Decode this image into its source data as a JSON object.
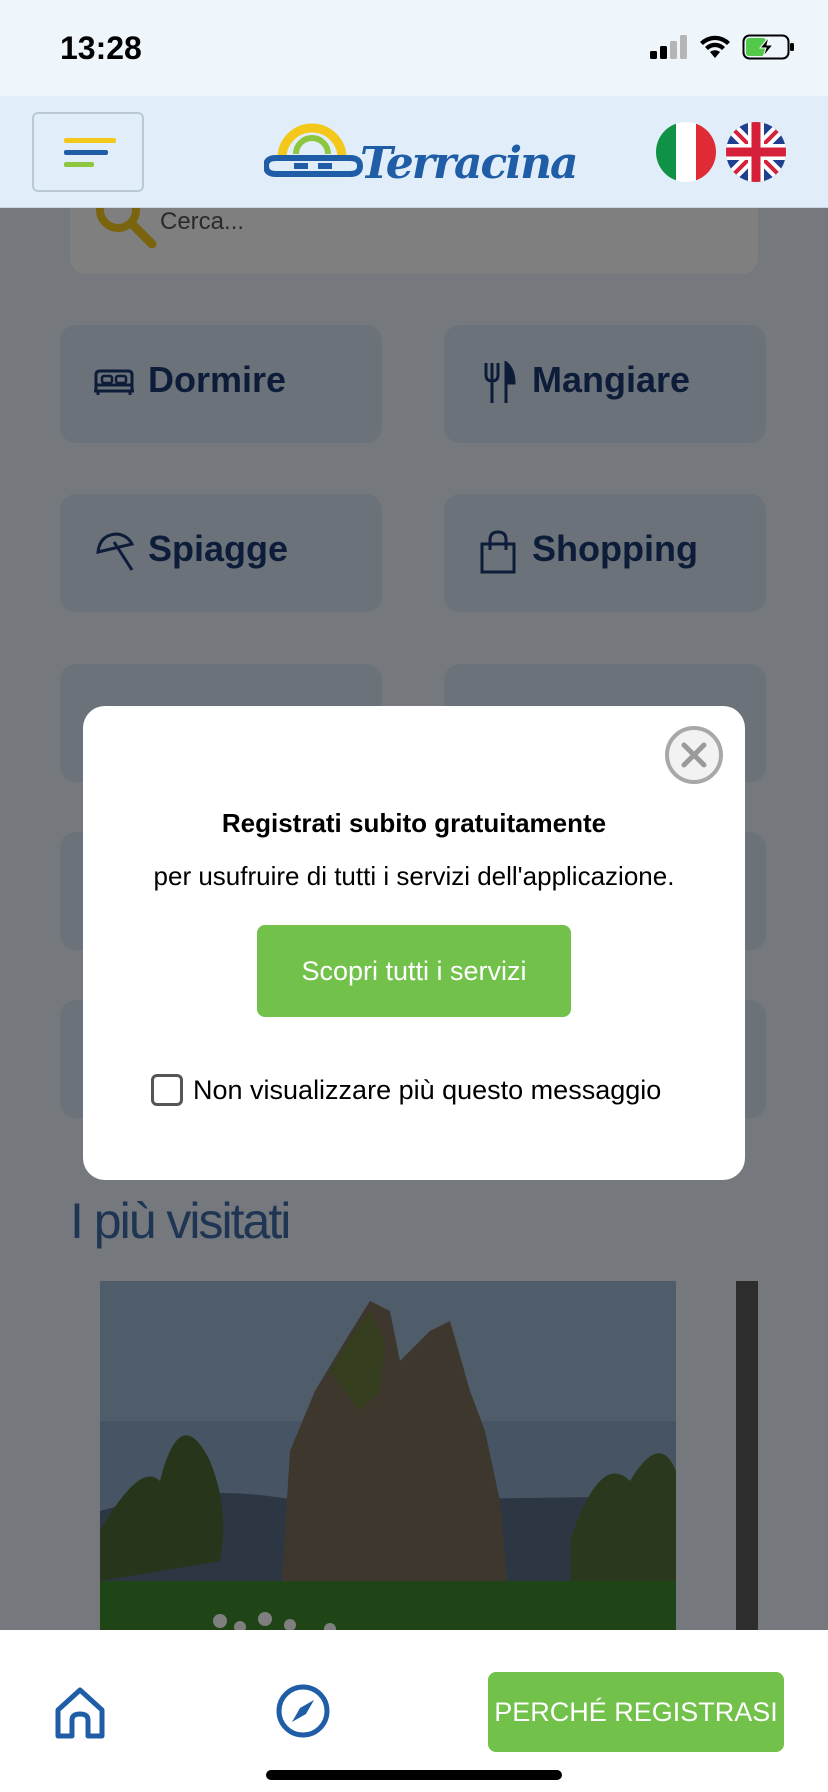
{
  "status_bar": {
    "time": "13:28"
  },
  "header": {
    "logo_text": "Terracina",
    "colors": {
      "header_bg": "#e1edf8",
      "brand_blue": "#1f5da6",
      "brand_yellow": "#f4c81a",
      "brand_green": "#8dc63f"
    }
  },
  "main": {
    "search_placeholder": "Cerca...",
    "categories": [
      {
        "label": "Dormire",
        "icon": "bed-icon"
      },
      {
        "label": "Mangiare",
        "icon": "fork-knife-icon"
      },
      {
        "label": "Spiagge",
        "icon": "umbrella-icon"
      },
      {
        "label": "Shopping",
        "icon": "shopping-bag-icon"
      }
    ],
    "section_title": "I più visitati"
  },
  "modal": {
    "title": "Registrati subito gratuitamente",
    "subtitle": "per usufruire di tutti i servizi dell'applicazione.",
    "cta_label": "Scopri tutti i servizi",
    "checkbox_label": "Non visualizzare più questo messaggio",
    "checkbox_checked": false,
    "cta_color": "#72c14b"
  },
  "bottom_bar": {
    "register_label": "PERCHÉ REGISTRASI",
    "icons": [
      "home-icon",
      "compass-icon"
    ]
  }
}
